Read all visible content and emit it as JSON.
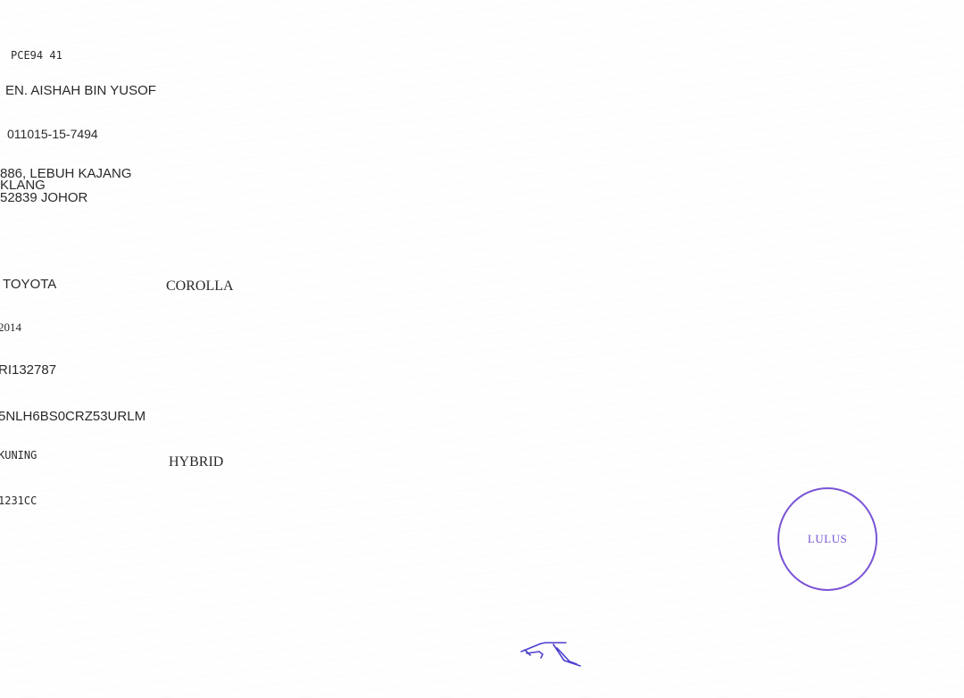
{
  "owner": {
    "plate_code": "PCE94 41",
    "name": "EN. AISHAH BIN YUSOF",
    "ic_number": "011015-15-7494",
    "address_line1": "886, LEBUH KAJANG",
    "address_line2": "KLANG",
    "address_line3": "52839 JOHOR"
  },
  "vehicle": {
    "make": "TOYOTA",
    "model": "COROLLA",
    "year": "2014",
    "engine_number": "RI132787",
    "chassis_number": "5NLH6BS0CRZ53URLM",
    "color": "KUNING",
    "fuel": "HYBRID",
    "capacity": "1231CC"
  },
  "stamp": {
    "text": "LULUS",
    "color": "#7a55d6"
  },
  "signature": {
    "color": "#4a3fd0"
  }
}
